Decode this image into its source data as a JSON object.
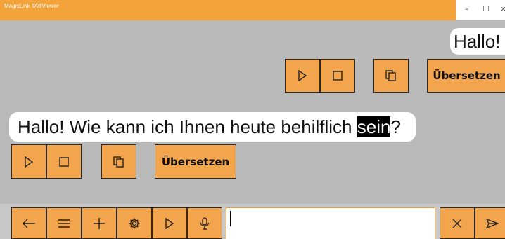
{
  "window": {
    "title": "MagniLink TABViewer"
  },
  "window_controls": {
    "minimize": "–",
    "maximize": "☐",
    "close": "×"
  },
  "messages": {
    "short": "Hallo!",
    "long_before": "Hallo! Wie kann ich Ihnen heute behilflich ",
    "long_highlight": "sein",
    "long_after": "?"
  },
  "actions": {
    "translate_label": "Übersetzen"
  },
  "colors": {
    "accent": "#f3a54e",
    "titlebar": "#f3a33a",
    "background": "#b9b9b9",
    "highlight": "#000000"
  },
  "icons": {
    "play": "play-icon",
    "stop": "stop-icon",
    "copy": "copy-icon",
    "back": "arrow-left-icon",
    "menu": "menu-icon",
    "add": "plus-icon",
    "settings": "gear-icon",
    "mic": "microphone-icon",
    "clear": "close-icon",
    "send": "send-icon"
  },
  "input": {
    "value": ""
  }
}
